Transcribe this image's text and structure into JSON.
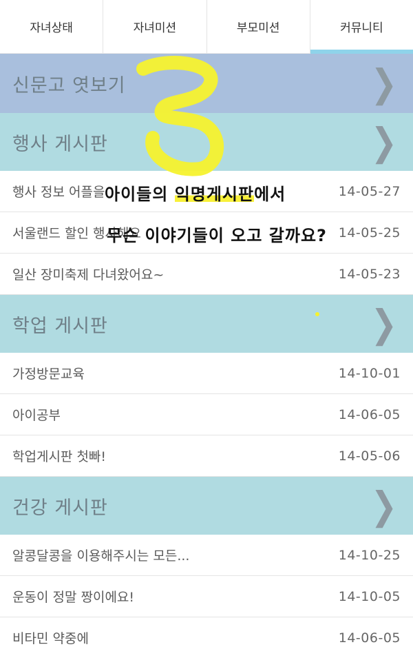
{
  "tabs": [
    {
      "label": "자녀상태"
    },
    {
      "label": "자녀미션"
    },
    {
      "label": "부모미션"
    },
    {
      "label": "커뮤니티"
    }
  ],
  "sections": {
    "news": {
      "title": "신문고 엿보기"
    },
    "event": {
      "title": "행사 게시판",
      "posts": [
        {
          "title": "행사 정보 어플을",
          "date": "14-05-27"
        },
        {
          "title": "서울랜드 할인 행사해요",
          "date": "14-05-25"
        },
        {
          "title": "일산 장미축제 다녀왔어요~",
          "date": "14-05-23"
        }
      ]
    },
    "study": {
      "title": "학업 게시판",
      "posts": [
        {
          "title": "가정방문교육",
          "date": "14-10-01"
        },
        {
          "title": "아이공부",
          "date": "14-06-05"
        },
        {
          "title": "학업게시판 첫빠!",
          "date": "14-05-06"
        }
      ]
    },
    "health": {
      "title": "건강 게시판",
      "posts": [
        {
          "title": "알콩달콩을 이용해주시는 모든...",
          "date": "14-10-25"
        },
        {
          "title": "운동이 정말 짱이에요!",
          "date": "14-10-05"
        },
        {
          "title": "비타민 약중에",
          "date": "14-06-05"
        }
      ]
    }
  },
  "annotation": {
    "line1_a": "아이들의 ",
    "line1_b": "익명게시판",
    "line1_c": "에서",
    "line2": "무슨 이야기들이 오고 갈까요?"
  },
  "colors": {
    "active_tab": "#8fd3ea",
    "news_header": "#a9bfdd",
    "board_header": "#b0dbe1",
    "highlight": "#f8f03a"
  },
  "icons": {
    "chevron": "chevron-right-icon"
  }
}
